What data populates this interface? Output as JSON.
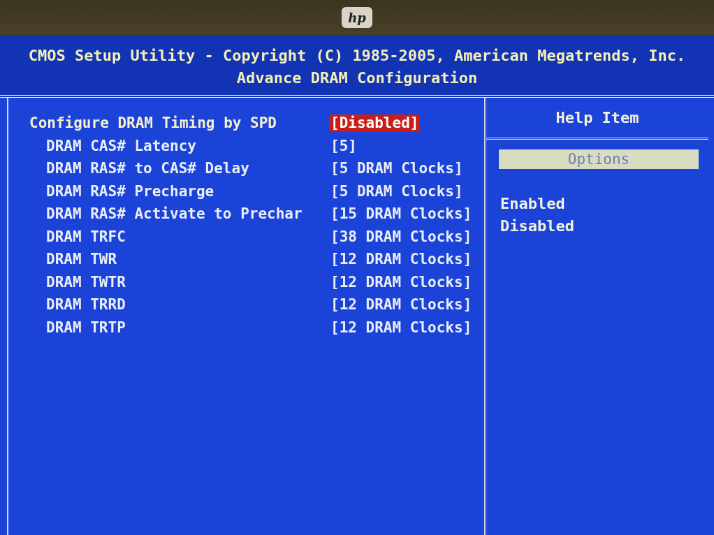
{
  "bezel": {
    "logo": "hp"
  },
  "header": {
    "title": "CMOS Setup Utility - Copyright (C) 1985-2005, American Megatrends, Inc.",
    "subtitle": "Advance DRAM Configuration"
  },
  "settings": [
    {
      "label": "Configure DRAM Timing by SPD",
      "value": "[Disabled]",
      "selected": true,
      "children": [
        {
          "label": "DRAM CAS# Latency",
          "value": "[5]",
          "selected": false
        },
        {
          "label": "DRAM RAS# to CAS# Delay",
          "value": "[5 DRAM Clocks]",
          "selected": false
        },
        {
          "label": "DRAM RAS# Precharge",
          "value": "[5 DRAM Clocks]",
          "selected": false
        },
        {
          "label": "DRAM RAS# Activate to Prechar",
          "value": "[15 DRAM Clocks]",
          "selected": false
        },
        {
          "label": "DRAM TRFC",
          "value": "[38 DRAM Clocks]",
          "selected": false
        },
        {
          "label": "DRAM TWR",
          "value": "[12 DRAM Clocks]",
          "selected": false
        },
        {
          "label": "DRAM TWTR",
          "value": "[12 DRAM Clocks]",
          "selected": false
        },
        {
          "label": "DRAM TRRD",
          "value": "[12 DRAM Clocks]",
          "selected": false
        },
        {
          "label": "DRAM TRTP",
          "value": "[12 DRAM Clocks]",
          "selected": false
        }
      ]
    }
  ],
  "help": {
    "title": "Help Item",
    "options_header": "Options",
    "options": [
      "Enabled",
      "Disabled"
    ]
  }
}
